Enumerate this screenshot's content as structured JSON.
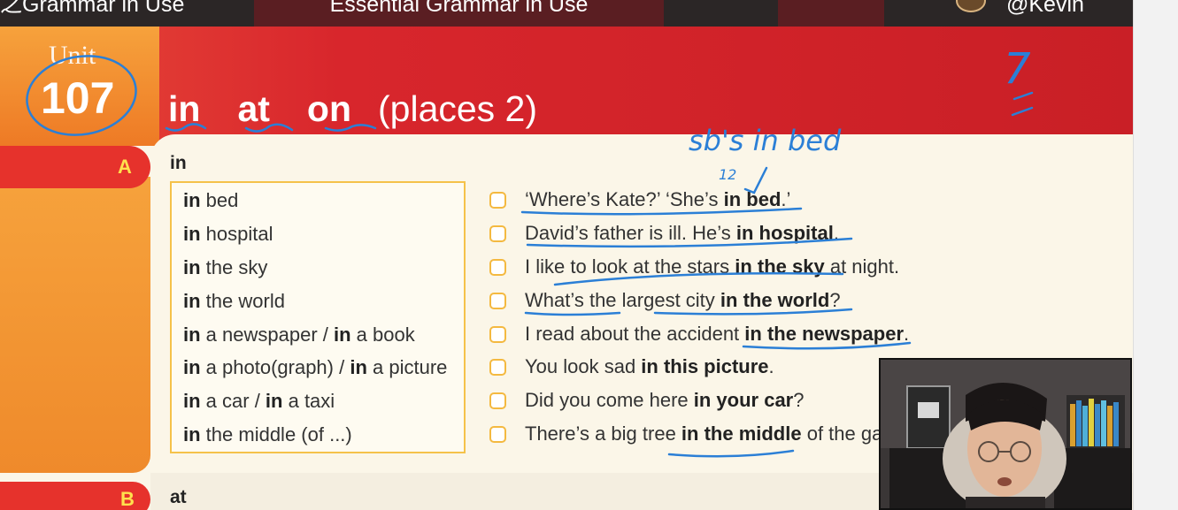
{
  "topbar": {
    "left_title": "之Grammar in Use",
    "center_title": "Essential Grammar in Use",
    "right_title": "@Kevin"
  },
  "unit": {
    "label": "Unit",
    "number": "107",
    "title_keywords": [
      "in",
      "at",
      "on"
    ],
    "title_rest": "(places 2)"
  },
  "section_a": {
    "letter": "A",
    "title": "in",
    "phrases": [
      [
        {
          "b": "in"
        },
        {
          "t": " bed"
        }
      ],
      [
        {
          "b": "in"
        },
        {
          "t": " hospital"
        }
      ],
      [
        {
          "b": "in"
        },
        {
          "t": " the sky"
        }
      ],
      [
        {
          "b": "in"
        },
        {
          "t": " the world"
        }
      ],
      [
        {
          "b": "in"
        },
        {
          "t": " a newspaper / "
        },
        {
          "b": "in"
        },
        {
          "t": " a book"
        }
      ],
      [
        {
          "b": "in"
        },
        {
          "t": " a photo(graph) / "
        },
        {
          "b": "in"
        },
        {
          "t": " a picture"
        }
      ],
      [
        {
          "b": "in"
        },
        {
          "t": " a car / "
        },
        {
          "b": "in"
        },
        {
          "t": " a taxi"
        }
      ],
      [
        {
          "b": "in"
        },
        {
          "t": " the middle (of ...)"
        }
      ]
    ],
    "examples": [
      [
        {
          "t": "‘Where’s Kate?’    ‘She’s "
        },
        {
          "b": "in bed"
        },
        {
          "t": ".’"
        }
      ],
      [
        {
          "t": "David’s father is ill.  He’s "
        },
        {
          "b": "in hospital"
        },
        {
          "t": "."
        }
      ],
      [
        {
          "t": "I like to look at the stars "
        },
        {
          "b": "in the sky"
        },
        {
          "t": " at night."
        }
      ],
      [
        {
          "t": "What’s the largest city "
        },
        {
          "b": "in the world"
        },
        {
          "t": "?"
        }
      ],
      [
        {
          "t": "I read about the accident "
        },
        {
          "b": "in the newspaper"
        },
        {
          "t": "."
        }
      ],
      [
        {
          "t": "You look sad "
        },
        {
          "b": "in this picture"
        },
        {
          "t": "."
        }
      ],
      [
        {
          "t": "Did you come here "
        },
        {
          "b": "in your car"
        },
        {
          "t": "?"
        }
      ],
      [
        {
          "t": "There’s a big tree "
        },
        {
          "b": "in the middle"
        },
        {
          "t": " of the ga"
        }
      ]
    ]
  },
  "section_b": {
    "letter": "B",
    "title": "at"
  },
  "annotations": {
    "note": "sb's  in  bed",
    "note_small": "12",
    "mark": "7"
  },
  "colors": {
    "ink": "#2b7fd6",
    "header_red": "#d8262c",
    "unit_orange": "#f0852a",
    "checkbox": "#f4b940"
  },
  "icons": {
    "app_logo": "avatar-logo-icon"
  }
}
